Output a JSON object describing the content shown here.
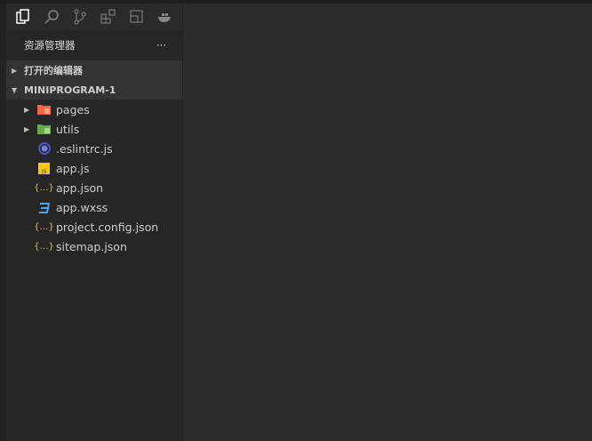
{
  "sidebar": {
    "title": "资源管理器",
    "more": "···",
    "sections": [
      {
        "label": "打开的编辑器",
        "expanded": false
      },
      {
        "label": "MINIPROGRAM-1",
        "expanded": true
      }
    ],
    "items": [
      {
        "label": "pages",
        "type": "folder",
        "icon": "folder-pages-icon"
      },
      {
        "label": "utils",
        "type": "folder",
        "icon": "folder-utils-icon"
      },
      {
        "label": ".eslintrc.js",
        "type": "file",
        "icon": "eslint-icon"
      },
      {
        "label": "app.js",
        "type": "file",
        "icon": "js-icon"
      },
      {
        "label": "app.json",
        "type": "file",
        "icon": "json-icon"
      },
      {
        "label": "app.wxss",
        "type": "file",
        "icon": "css-icon"
      },
      {
        "label": "project.config.json",
        "type": "file",
        "icon": "json-icon"
      },
      {
        "label": "sitemap.json",
        "type": "file",
        "icon": "json-icon"
      }
    ]
  }
}
